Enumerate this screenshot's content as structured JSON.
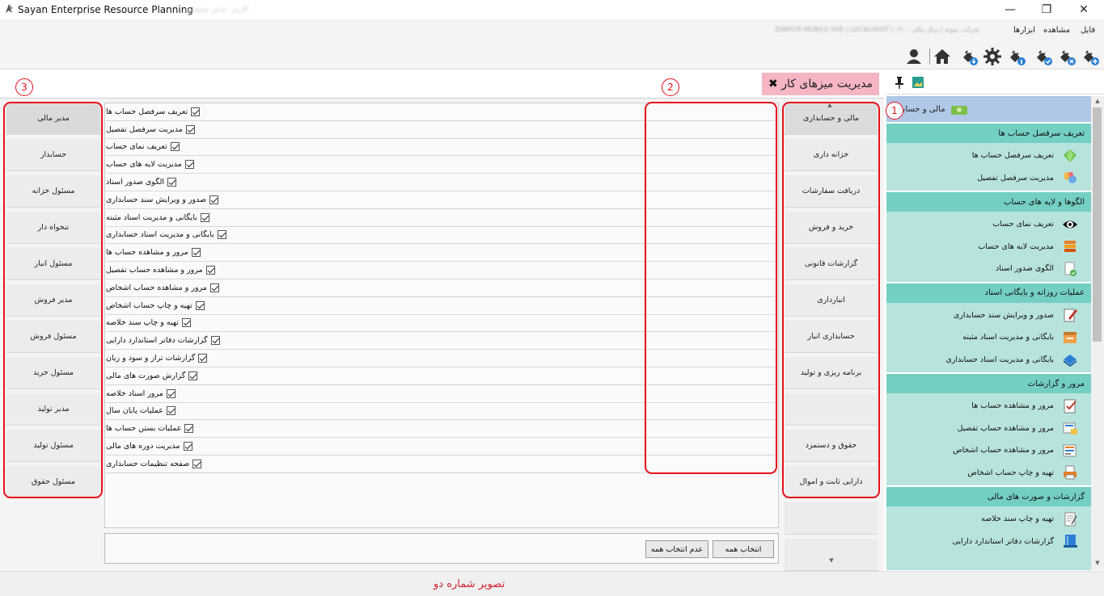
{
  "app": {
    "title": "Sayan Enterprise Resource Planning",
    "blurred_subtitle": "کاربر: مدیر سیستم",
    "blurred_info": "ZARPOR-MOBILE-SVR | LOCALHOST | شرکت نمونه | سال مالی ۱۴۰۰"
  },
  "window": {
    "minimize": "—",
    "maximize": "❐",
    "close": "✕"
  },
  "menu": {
    "file": "فایل",
    "view": "مشاهده",
    "tools": "ابزارها"
  },
  "toolbar": {
    "icons": [
      "user-icon",
      "home-icon",
      "plug-download-icon",
      "gear-icon",
      "plug-info-icon",
      "plug-check-icon",
      "plug-remove-icon",
      "plug-add-icon"
    ]
  },
  "tab": {
    "title": "مدیریت میزهای کار",
    "close": "✖"
  },
  "nav": {
    "group_title": "مالی و حسابداری",
    "sections": [
      {
        "title": "تعریف سرفصل حساب ها",
        "items": [
          {
            "label": "تعریف سرفصل حساب ها",
            "icon": "green-diamond-icon"
          },
          {
            "label": "مدیریت سرفصل تفصیل",
            "icon": "gem-cluster-icon"
          }
        ]
      },
      {
        "title": "الگوها و لایه های حساب",
        "items": [
          {
            "label": "تعریف نمای حساب",
            "icon": "eye-icon"
          },
          {
            "label": "مدیریت لایه های حساب",
            "icon": "layers-icon"
          },
          {
            "label": "الگوی صدور اسناد",
            "icon": "document-check-icon"
          }
        ]
      },
      {
        "title": "عملیات روزانه و بایگانی اسناد",
        "items": [
          {
            "label": "صدور و ویرایش سند حسابداری",
            "icon": "edit-document-icon"
          },
          {
            "label": "بایگانی و مدیریت اسناد مثبته",
            "icon": "archive-box-icon"
          },
          {
            "label": "بایگانی و مدیریت اسناد حسابداری",
            "icon": "blue-book-icon"
          }
        ]
      },
      {
        "title": "مرور و گزارشات",
        "items": [
          {
            "label": "مرور و مشاهده حساب ها",
            "icon": "report-check-icon"
          },
          {
            "label": "مرور و مشاهده حساب تفصیل",
            "icon": "report-folder-icon"
          },
          {
            "label": "مرور و مشاهده حساب اشخاص",
            "icon": "report-person-icon"
          },
          {
            "label": "تهیه و چاپ حساب اشخاص",
            "icon": "print-report-icon"
          }
        ]
      },
      {
        "title": "گزارشات و صورت های مالی",
        "items": [
          {
            "label": "تهیه و چاپ سند خلاصه",
            "icon": "note-icon"
          },
          {
            "label": "گزارشات دفاتر استاندارد دارایی",
            "icon": "ledger-icon"
          }
        ]
      }
    ]
  },
  "categories": [
    "مالی و حسابداری",
    "خزانه داری",
    "دریافت سفارشات",
    "خرید و فروش",
    "گزارشات قانونی",
    "انبارداری",
    "حسابداری انبار",
    "برنامه ریزی و تولید",
    "",
    "حقوق و دستمزد",
    "دارایی ثابت و اموال",
    "",
    ""
  ],
  "permissions": [
    "تعریف سرفصل حساب ها",
    "مدیریت سرفصل تفصیل",
    "تعریف نمای حساب",
    "مدیریت لایه های حساب",
    "الگوی صدور اسناد",
    "صدور و ویرایش سند حسابداری",
    "بایگانی و مدیریت اسناد مثبته",
    "بایگانی و مدیریت اسناد حسابداری",
    "مرور و مشاهده حساب ها",
    "مرور و مشاهده حساب تفصیل",
    "مرور و مشاهده حساب اشخاص",
    "تهیه و چاپ حساب اشخاص",
    "تهیه و چاپ سند خلاصه",
    "گزارشات دفاتر استاندارد دارایی",
    "گزارشات تراز و سود و زیان",
    "گزارش صورت های مالی",
    "مرور اسناد خلاصه",
    "عملیات پایان سال",
    "عملیات بستن حساب ها",
    "مدیریت دوره های مالی",
    "صفحه تنظیمات حسابداری"
  ],
  "actions": {
    "select_all": "انتخاب همه",
    "deselect_all": "عدم انتخاب همه"
  },
  "roles": [
    "مدیر مالی",
    "حسابدار",
    "مسئول خزانه",
    "تنخواه دار",
    "مسئول انبار",
    "مدیر فروش",
    "مسئول فروش",
    "مسئول خرید",
    "مدیر تولید",
    "مسئول تولید",
    "مسئول حقوق"
  ],
  "callouts": {
    "one": "1",
    "two": "2",
    "three": "3"
  },
  "scroll": {
    "up": "▲",
    "down": "▼"
  },
  "caption": "تصویر شماره دو",
  "colors": {
    "accent_red": "#e8101a",
    "nav_bg": "#b7e3dd",
    "nav_section": "#74cfc3",
    "tab_pink": "#f5b5c3"
  }
}
